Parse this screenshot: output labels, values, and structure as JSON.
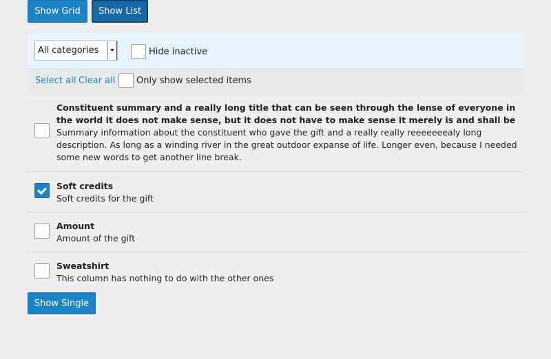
{
  "view_buttons": {
    "grid_label": "Show Grid",
    "list_label": "Show List"
  },
  "filter": {
    "category_selected": "All categories",
    "hide_inactive_label": "Hide inactive"
  },
  "selection": {
    "select_all": "Select all",
    "clear_all": "Clear all",
    "only_selected_label": "Only show selected items"
  },
  "items": [
    {
      "title": "Constituent summary and a really long title that can be seen through the lense of everyone in the world it does not make sense, but it does not have to make sense it merely is and shall be",
      "description": "Summary information about the constituent who gave the gift and a really really reeeeeeealy long description. As long as a winding river in the great outdoor expanse of life. Longer even, because I needed some new words to get another line break.",
      "checked": false
    },
    {
      "title": "Soft credits",
      "description": "Soft credits for the gift",
      "checked": true
    },
    {
      "title": "Amount",
      "description": "Amount of the gift",
      "checked": false
    },
    {
      "title": "Sweatshirt",
      "description": "This column has nothing to do with the other ones",
      "checked": false
    }
  ],
  "footer": {
    "single_label": "Show Single"
  },
  "colors": {
    "accent": "#1c84c6",
    "filter_bg": "#e6f2fc",
    "page_bg": "#efefef"
  }
}
